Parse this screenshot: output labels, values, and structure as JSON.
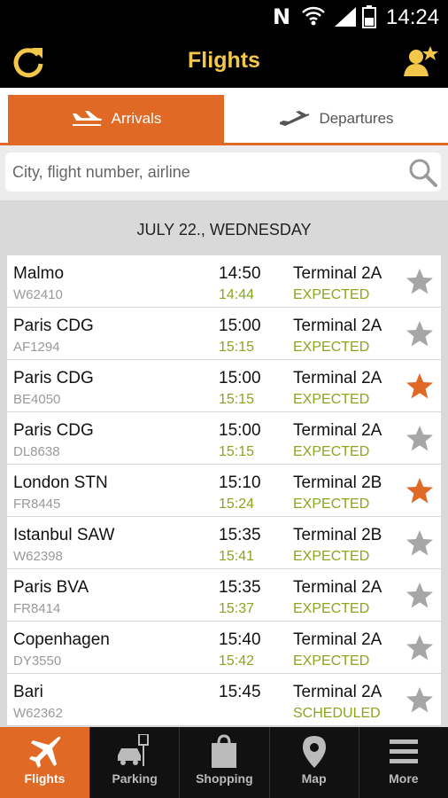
{
  "status_bar": {
    "time": "14:24",
    "n_label": "N"
  },
  "app_bar": {
    "title": "Flights"
  },
  "tabs": [
    {
      "label": "Arrivals",
      "active": true
    },
    {
      "label": "Departures",
      "active": false
    }
  ],
  "search": {
    "placeholder": "City, flight number, airline",
    "value": ""
  },
  "date_header": "JULY 22., WEDNESDAY",
  "flights": [
    {
      "city": "Malmo",
      "flight": "W62410",
      "scheduled": "14:50",
      "actual": "14:44",
      "terminal": "Terminal 2A",
      "status": "EXPECTED",
      "favorite": false
    },
    {
      "city": "Paris CDG",
      "flight": "AF1294",
      "scheduled": "15:00",
      "actual": "15:15",
      "terminal": "Terminal 2A",
      "status": "EXPECTED",
      "favorite": false
    },
    {
      "city": "Paris CDG",
      "flight": "BE4050",
      "scheduled": "15:00",
      "actual": "15:15",
      "terminal": "Terminal 2A",
      "status": "EXPECTED",
      "favorite": true
    },
    {
      "city": "Paris CDG",
      "flight": "DL8638",
      "scheduled": "15:00",
      "actual": "15:15",
      "terminal": "Terminal 2A",
      "status": "EXPECTED",
      "favorite": false
    },
    {
      "city": "London STN",
      "flight": "FR8445",
      "scheduled": "15:10",
      "actual": "15:24",
      "terminal": "Terminal 2B",
      "status": "EXPECTED",
      "favorite": true
    },
    {
      "city": "Istanbul SAW",
      "flight": "W62398",
      "scheduled": "15:35",
      "actual": "15:41",
      "terminal": "Terminal 2B",
      "status": "EXPECTED",
      "favorite": false
    },
    {
      "city": "Paris BVA",
      "flight": "FR8414",
      "scheduled": "15:35",
      "actual": "15:37",
      "terminal": "Terminal 2A",
      "status": "EXPECTED",
      "favorite": false
    },
    {
      "city": "Copenhagen",
      "flight": "DY3550",
      "scheduled": "15:40",
      "actual": "15:42",
      "terminal": "Terminal 2A",
      "status": "EXPECTED",
      "favorite": false
    },
    {
      "city": "Bari",
      "flight": "W62362",
      "scheduled": "15:45",
      "actual": "",
      "terminal": "Terminal 2A",
      "status": "SCHEDULED",
      "favorite": false
    }
  ],
  "bottom_nav": [
    {
      "label": "Flights",
      "icon": "plane-icon",
      "active": true
    },
    {
      "label": "Parking",
      "icon": "parking-icon",
      "active": false
    },
    {
      "label": "Shopping",
      "icon": "shopping-bag-icon",
      "active": false
    },
    {
      "label": "Map",
      "icon": "map-pin-icon",
      "active": false
    },
    {
      "label": "More",
      "icon": "menu-icon",
      "active": false
    }
  ],
  "colors": {
    "accent": "#e06a25",
    "title": "#f3c74a",
    "status_green": "#8aa61c",
    "star_active": "#e06a25",
    "star_inactive": "#a6a6a6"
  }
}
